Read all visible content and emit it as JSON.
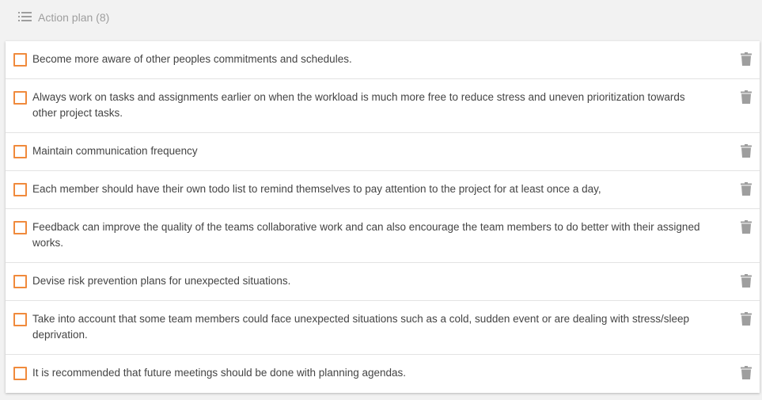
{
  "header": {
    "icon": "list-icon",
    "title": "Action plan (8)"
  },
  "colors": {
    "checkbox_border": "#f08a3c",
    "trash_icon": "#9e9e9e"
  },
  "items": [
    {
      "label": "Become more aware of other peoples commitments and schedules.",
      "checked": false
    },
    {
      "label": "Always work on tasks and assignments earlier on when the workload is much more free to reduce stress and uneven prioritization towards other project tasks.",
      "checked": false
    },
    {
      "label": "Maintain communication frequency",
      "checked": false
    },
    {
      "label": "Each member should have their own todo list to remind themselves to pay attention to the project for at least once a day,",
      "checked": false
    },
    {
      "label": "Feedback can improve the quality of the teams collaborative work and can also encourage the team members to do better with their assigned works.",
      "checked": false
    },
    {
      "label": "Devise risk prevention plans for unexpected situations.",
      "checked": false
    },
    {
      "label": "Take into account that some team members could face unexpected situations such as a cold, sudden event or are dealing with stress/sleep deprivation.",
      "checked": false
    },
    {
      "label": "It is recommended that future meetings should be done with planning agendas.",
      "checked": false
    }
  ]
}
